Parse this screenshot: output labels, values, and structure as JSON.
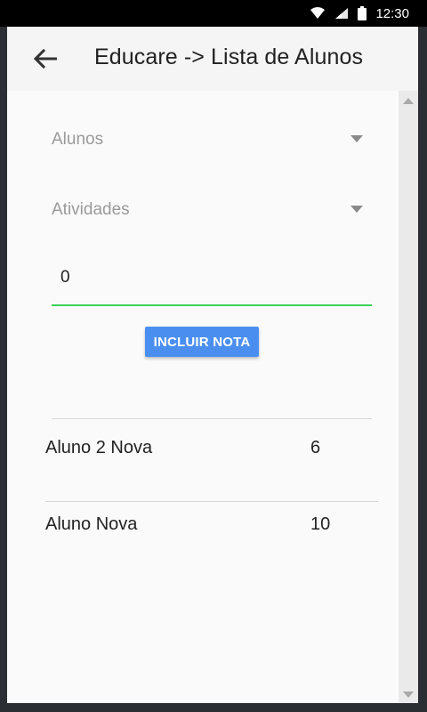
{
  "status_bar": {
    "time": "12:30",
    "icons": [
      "wifi-icon",
      "signal-icon",
      "battery-icon"
    ]
  },
  "app_bar": {
    "title": "Educare -> Lista de Alunos",
    "back_icon": "arrow-left-icon"
  },
  "form": {
    "students_dropdown": {
      "selected": "Alunos"
    },
    "activities_dropdown": {
      "selected": "Atividades"
    },
    "note_input": {
      "value": "0"
    },
    "add_note_label": "INCLUIR NOTA"
  },
  "grades": [
    {
      "student": "Aluno 2 Nova",
      "grade": "6"
    },
    {
      "student": "Aluno Nova",
      "grade": "10"
    }
  ],
  "colors": {
    "accent": "#4a8ff0",
    "input_focus": "#3cd25a",
    "app_bar": "#f5f5f5"
  }
}
